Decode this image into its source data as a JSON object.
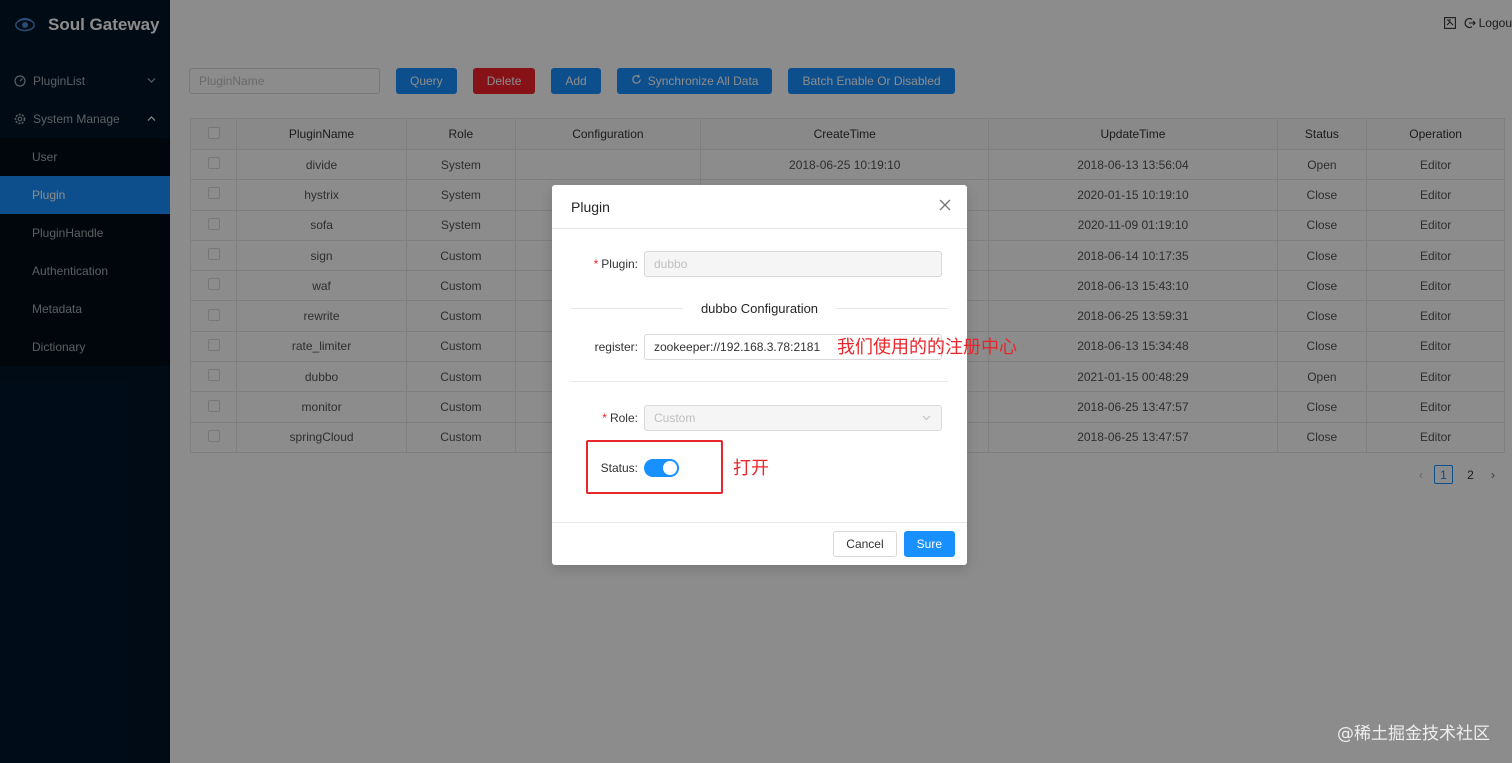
{
  "app": {
    "title": "Soul Gateway"
  },
  "header": {
    "logout_label": "Logou"
  },
  "sidebar": {
    "items": [
      {
        "label": "PluginList",
        "arrow": "⌄"
      },
      {
        "label": "System Manage",
        "arrow": "⌃"
      }
    ],
    "submenu": [
      {
        "label": "User"
      },
      {
        "label": "Plugin"
      },
      {
        "label": "PluginHandle"
      },
      {
        "label": "Authentication"
      },
      {
        "label": "Metadata"
      },
      {
        "label": "Dictionary"
      }
    ]
  },
  "toolbar": {
    "search_placeholder": "PluginName",
    "query_label": "Query",
    "delete_label": "Delete",
    "add_label": "Add",
    "sync_label": "Synchronize All Data",
    "batch_label": "Batch Enable Or Disabled"
  },
  "table": {
    "headers": [
      "PluginName",
      "Role",
      "Configuration",
      "CreateTime",
      "UpdateTime",
      "Status",
      "Operation"
    ],
    "rows": [
      {
        "name": "divide",
        "role": "System",
        "config": "",
        "create": "2018-06-25 10:19:10",
        "update": "2018-06-13 13:56:04",
        "status": "Open",
        "op": "Editor"
      },
      {
        "name": "hystrix",
        "role": "System",
        "config": "",
        "create": "",
        "update": "2020-01-15 10:19:10",
        "status": "Close",
        "op": "Editor"
      },
      {
        "name": "sofa",
        "role": "System",
        "config": "",
        "create": "",
        "update": "2020-11-09 01:19:10",
        "status": "Close",
        "op": "Editor"
      },
      {
        "name": "sign",
        "role": "Custom",
        "config": "",
        "create": "",
        "update": "2018-06-14 10:17:35",
        "status": "Close",
        "op": "Editor"
      },
      {
        "name": "waf",
        "role": "Custom",
        "config": "",
        "create": "",
        "update": "2018-06-13 15:43:10",
        "status": "Close",
        "op": "Editor"
      },
      {
        "name": "rewrite",
        "role": "Custom",
        "config": "",
        "create": "",
        "update": "2018-06-25 13:59:31",
        "status": "Close",
        "op": "Editor"
      },
      {
        "name": "rate_limiter",
        "role": "Custom",
        "config": "",
        "create": "",
        "update": "2018-06-13 15:34:48",
        "status": "Close",
        "op": "Editor"
      },
      {
        "name": "dubbo",
        "role": "Custom",
        "config": "",
        "create": "",
        "update": "2021-01-15 00:48:29",
        "status": "Open",
        "op": "Editor"
      },
      {
        "name": "monitor",
        "role": "Custom",
        "config": "",
        "create": "",
        "update": "2018-06-25 13:47:57",
        "status": "Close",
        "op": "Editor"
      },
      {
        "name": "springCloud",
        "role": "Custom",
        "config": "",
        "create": "",
        "update": "2018-06-25 13:47:57",
        "status": "Close",
        "op": "Editor"
      }
    ]
  },
  "pagination": {
    "pages": [
      "1",
      "2"
    ],
    "current": "1"
  },
  "modal": {
    "title": "Plugin",
    "plugin_label": "Plugin",
    "plugin_value": "dubbo",
    "section_title": "dubbo Configuration",
    "register_label": "register",
    "register_value": "zookeeper://192.168.3.78:2181",
    "role_label": "Role",
    "role_value": "Custom",
    "status_label": "Status",
    "status_on": true,
    "cancel_label": "Cancel",
    "sure_label": "Sure"
  },
  "annotations": {
    "register_note": "我们使用的的注册中心",
    "status_note": "打开",
    "watermark": "@稀土掘金技术社区"
  },
  "colors": {
    "primary": "#1890ff",
    "danger": "#f5222d",
    "open": "#52c41a",
    "sidebar": "#001529",
    "annotation": "#e8272d"
  }
}
